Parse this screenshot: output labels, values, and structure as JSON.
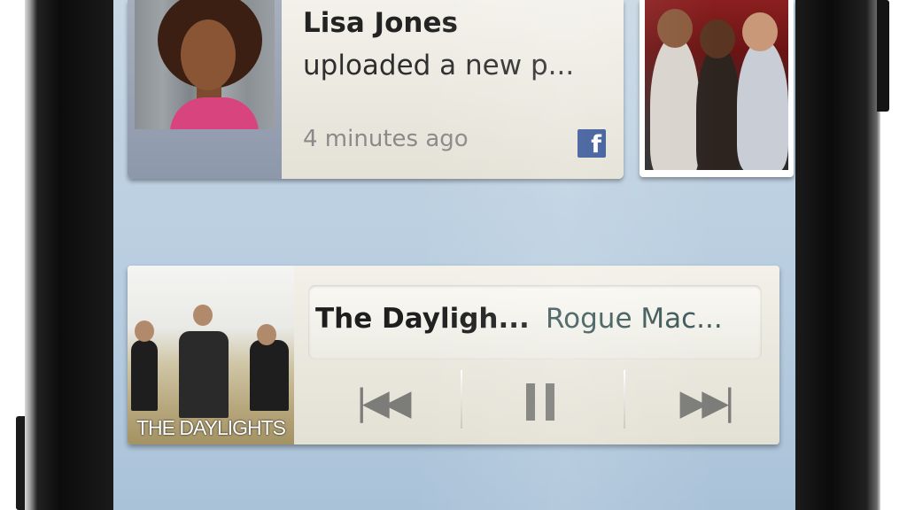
{
  "social_widget": {
    "name": "Lisa Jones",
    "activity": "uploaded a new p...",
    "time": "4 minutes ago",
    "network_icon": "facebook-icon",
    "network_glyph": "f"
  },
  "music_widget": {
    "album_art_text": "THE DAYLIGHTS",
    "artist": "The Dayligh...",
    "track": "Rogue Mac...",
    "controls": {
      "previous_glyph": "|◀◀",
      "next_glyph": "▶▶|"
    }
  },
  "colors": {
    "facebook": "#3b5998",
    "screen_bg": "#bcd0e1",
    "card_bg": "#f2f0e8"
  }
}
